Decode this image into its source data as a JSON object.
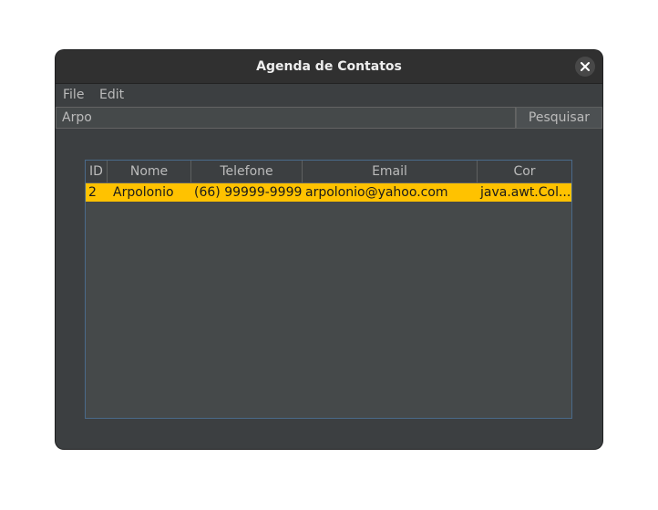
{
  "window": {
    "title": "Agenda de Contatos"
  },
  "menu": {
    "items": [
      "File",
      "Edit"
    ]
  },
  "search": {
    "value": "Arpo",
    "button_label": "Pesquisar"
  },
  "table": {
    "columns": [
      "ID",
      "Nome",
      "Telefone",
      "Email",
      "Cor"
    ],
    "rows": [
      [
        "2",
        "Arpolonio",
        "(66) 99999-9999",
        "arpolonio@yahoo.com",
        "java.awt.Col..."
      ]
    ],
    "selected_row": 0
  },
  "colors": {
    "selection": "#ffc200",
    "window_bg": "#3c3f41",
    "table_border": "#4a6a8a"
  }
}
